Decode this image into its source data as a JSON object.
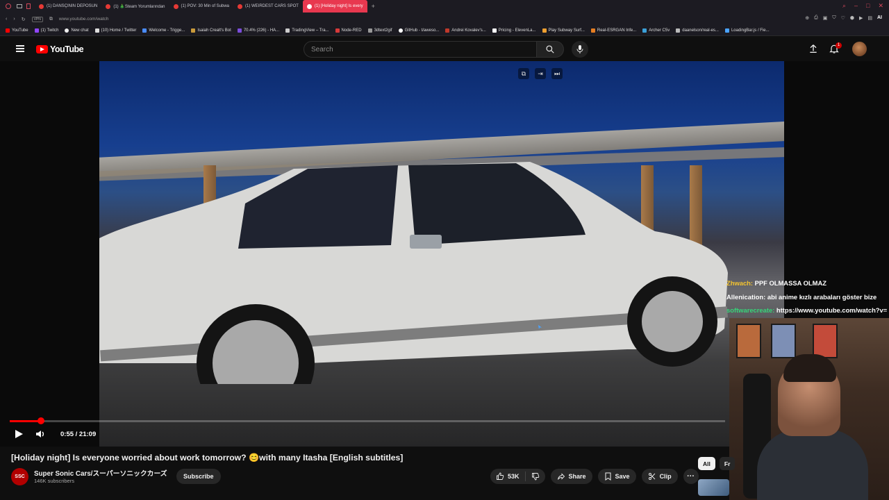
{
  "browser": {
    "tabs": [
      {
        "label": "(1) DANSÇININ DEPOSUN",
        "active": false
      },
      {
        "label": "(1) 🎄Steam Yorumlarından",
        "active": false
      },
      {
        "label": "(1) POV: 30 Min of Subwa",
        "active": false
      },
      {
        "label": "(1) WEIRDEST CARS SPOT",
        "active": false
      },
      {
        "label": "(1) [Holiday night] Is every",
        "active": true
      }
    ],
    "url": "www.youtube.com/watch",
    "vpn_label": "VPN",
    "bookmarks": [
      "YouTube",
      "(1) Twitch",
      "New chat",
      "(10) Home / Twitter",
      "Welcome - Trigge...",
      "Isaiah Crealt's Bot",
      "70.4% (226) - HA...",
      "TradingView – Tra...",
      "Node-RED",
      "3dtext2gif",
      "GitHub - t/aweso...",
      "Andrei Kovalev's...",
      "Pricing - ElevenLa...",
      "Play Subway Surf...",
      "Real-ESRGAN Infe...",
      "Archer C5v",
      "daanelson/real-es...",
      "LoadingBar.js / Fie..."
    ]
  },
  "youtube": {
    "logo_text": "YouTube",
    "search_placeholder": "Search",
    "notification_count": "1"
  },
  "player": {
    "current_time": "0:55",
    "duration": "21:09",
    "timecode": "0:55 / 21:09",
    "progress_fraction": 0.0433
  },
  "chat": [
    {
      "user": "Zhwach:",
      "message": "PPF OLMASSA OLMAZ"
    },
    {
      "user": "Allenication:",
      "message": "abi anime kızlı arabaları göster bize"
    },
    {
      "user": "softwarecreate:",
      "message": "https://www.youtube.com/watch?v="
    }
  ],
  "video": {
    "title": "[Holiday night] Is everyone worried about work tomorrow? 😊with many Itasha [English subtitles]",
    "channel_name": "Super Sonic Cars/スーパーソニックカーズ",
    "channel_avatar_text": "SSC",
    "subscribers": "146K subscribers",
    "subscribe_label": "Subscribe",
    "like_count": "53K",
    "share_label": "Share",
    "save_label": "Save",
    "clip_label": "Clip",
    "more_label": "···"
  },
  "chips": [
    "All",
    "Fr"
  ],
  "colors": {
    "brand_red": "#ff0000",
    "background": "#0f0f0f",
    "tab_active": "#e8384f"
  }
}
